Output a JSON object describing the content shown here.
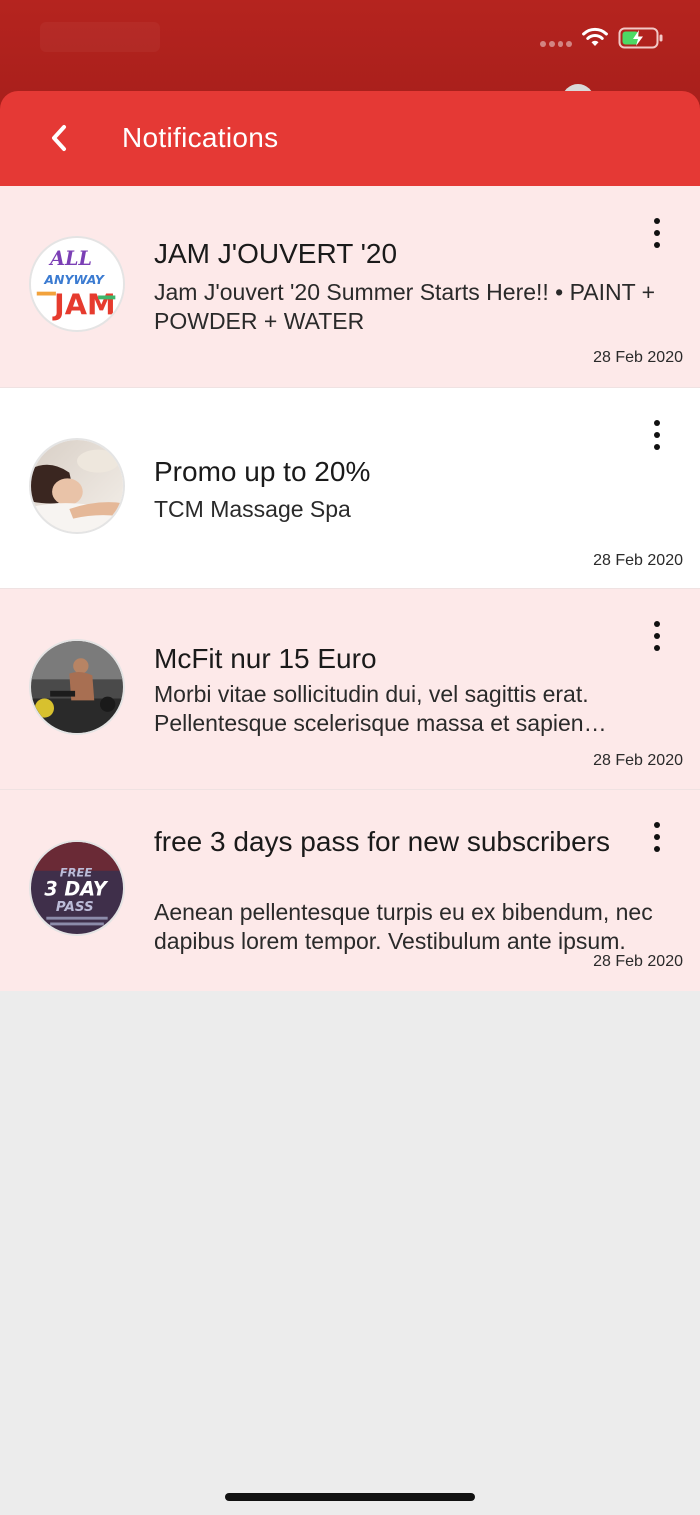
{
  "header": {
    "title": "Notifications",
    "back_icon": "chevron-left-icon"
  },
  "status_bar": {
    "wifi_icon": "wifi-icon",
    "battery_icon": "battery-charging-icon",
    "signal_icon": "signal-dots-icon"
  },
  "notifications": [
    {
      "title": "JAM J'OUVERT '20",
      "body": "Jam J'ouvert '20 Summer Starts Here!! • PAINT + POWDER + WATER",
      "date": "28 Feb 2020",
      "read": false,
      "avatar": "jam-jouvert-logo-image",
      "avatar_text_top": "ALL",
      "avatar_text_mid": "ANYWAY",
      "avatar_text_bottom": "JAM"
    },
    {
      "title": "Promo up to 20%",
      "body": "TCM Massage Spa",
      "date": "28 Feb 2020",
      "read": true,
      "avatar": "massage-spa-photo"
    },
    {
      "title": "McFit nur 15 Euro",
      "body": "Morbi vitae sollicitudin dui, vel sagittis erat. Pellentesque scelerisque massa et sapien vulputate.",
      "date": "28 Feb 2020",
      "read": false,
      "avatar": "gym-workout-photo"
    },
    {
      "title": "free 3 days pass for new subscribers",
      "body": "Aenean pellentesque turpis eu ex bibendum, nec dapibus lorem tempor. Vestibulum ante ipsum.",
      "date": "28 Feb 2020",
      "read": false,
      "avatar": "three-day-pass-poster",
      "avatar_text_top": "FREE",
      "avatar_text_mid": "3 DAY",
      "avatar_text_bottom": "PASS"
    }
  ],
  "colors": {
    "status_bar": "#b5241f",
    "header": "#e53935",
    "unread_bg": "#fde9e9",
    "read_bg": "#ffffff",
    "page_bg": "#ececec"
  }
}
